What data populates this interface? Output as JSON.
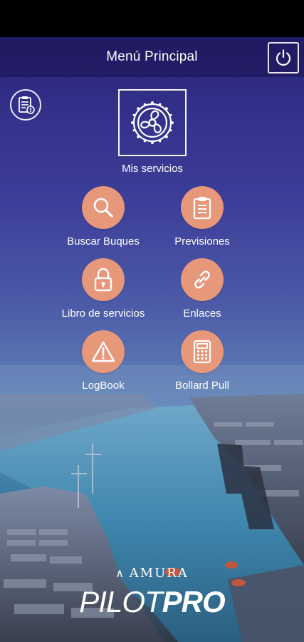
{
  "header": {
    "title": "Menú Principal",
    "power_icon": "power-icon"
  },
  "report_button": {
    "icon": "clipboard-report-icon"
  },
  "featured": {
    "label": "Mis servicios",
    "icon": "ship-propeller-icon"
  },
  "menu": [
    {
      "label": "Buscar Buques",
      "icon": "search-icon"
    },
    {
      "label": "Previsiones",
      "icon": "clipboard-icon"
    },
    {
      "label": "Libro de servicios",
      "icon": "lock-icon"
    },
    {
      "label": "Enlaces",
      "icon": "link-icon"
    },
    {
      "label": "LogBook",
      "icon": "warning-icon"
    },
    {
      "label": "Bollard Pull",
      "icon": "calculator-icon"
    }
  ],
  "brand": {
    "company": "AMURA",
    "product_light": "PILOT",
    "product_bold": "PRO"
  },
  "colors": {
    "header_bg": "#201a60",
    "accent_circle": "#e7977a",
    "text": "#ffffff"
  }
}
